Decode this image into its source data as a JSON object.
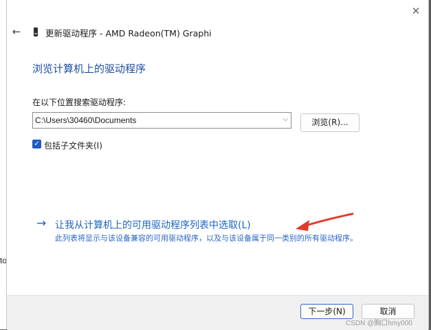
{
  "background": {
    "edge_char": "to"
  },
  "window": {
    "title": "更新驱动程序 - AMD Radeon(TM) Graphi",
    "close_glyph": "✕",
    "back_glyph": "←"
  },
  "main": {
    "heading": "浏览计算机上的驱动程序",
    "search_label": "在以下位置搜索驱动程序:",
    "path_value": "C:\\Users\\30460\\Documents",
    "dropdown_glyph": "⌵",
    "browse_button": "浏览(R)...",
    "include_subfolders": {
      "label": "包括子文件夹(I)",
      "checked": true,
      "check_glyph": "✓"
    },
    "pick_link": {
      "arrow_glyph": "→",
      "label": "让我从计算机上的可用驱动程序列表中选取(L)",
      "description": "此列表将显示与该设备兼容的可用驱动程序，以及与该设备属于同一类别的所有驱动程序。"
    }
  },
  "footer": {
    "next_button": "下一步(N)",
    "cancel_button": "取消"
  },
  "watermark": "CSDN @胸口hmy000",
  "colors": {
    "heading": "#1e4e9c",
    "link": "#1e63c2",
    "checkbox": "#1f5cbf",
    "annotation_arrow": "#e23b2b"
  },
  "icons": {
    "title_icon": "graphics-card-icon",
    "back": "back-arrow-icon",
    "close": "close-icon",
    "annotation": "red-pointer-arrow"
  }
}
